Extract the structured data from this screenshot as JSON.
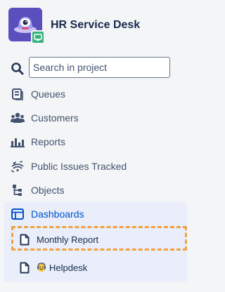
{
  "header": {
    "project_name": "HR Service Desk",
    "avatar_icon": "alien-ufo-avatar",
    "badge_icon": "service-desk-badge-icon",
    "colors": {
      "avatar_bg": "#5a4fbd",
      "badge": "#36b37e"
    }
  },
  "search": {
    "placeholder": "Search in project",
    "value": ""
  },
  "nav": {
    "items": [
      {
        "label": "Queues",
        "icon": "queues-icon"
      },
      {
        "label": "Customers",
        "icon": "customers-icon"
      },
      {
        "label": "Reports",
        "icon": "reports-icon"
      },
      {
        "label": "Public Issues Tracked",
        "icon": "public-issues-icon"
      },
      {
        "label": "Objects",
        "icon": "objects-icon"
      },
      {
        "label": "Dashboards",
        "icon": "dashboards-icon",
        "active": true
      }
    ],
    "dashboards": {
      "children": [
        {
          "label": "Monthly Report",
          "icon": "page-icon",
          "highlighted": true
        },
        {
          "label": "Helpdesk",
          "icon": "page-icon",
          "emoji": "helpdesk-emoji-icon"
        }
      ]
    }
  },
  "colors": {
    "active": "#0052cc",
    "highlight_border": "#f0a042",
    "active_bg": "#e9eefa"
  }
}
